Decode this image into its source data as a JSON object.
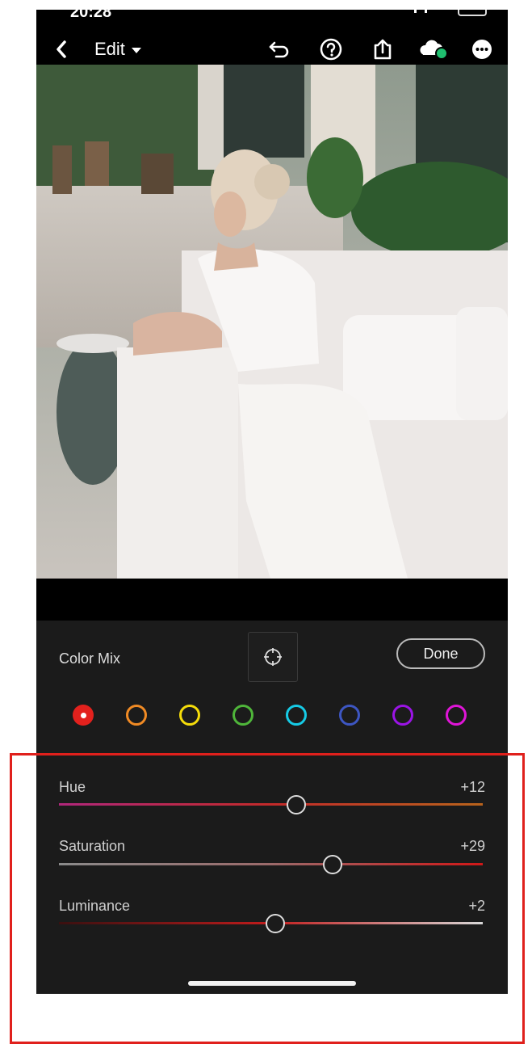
{
  "status_bar": {
    "time": "20:28"
  },
  "nav": {
    "title": "Edit"
  },
  "panel": {
    "title": "Color Mix",
    "done_label": "Done",
    "swatches": [
      {
        "name": "red",
        "color": "#e3211d",
        "selected": true
      },
      {
        "name": "orange",
        "color": "#f08a24",
        "selected": false
      },
      {
        "name": "yellow",
        "color": "#f5dc0a",
        "selected": false
      },
      {
        "name": "green",
        "color": "#4fb63a",
        "selected": false
      },
      {
        "name": "aqua",
        "color": "#16cbe6",
        "selected": false
      },
      {
        "name": "blue",
        "color": "#3d56c2",
        "selected": false
      },
      {
        "name": "purple",
        "color": "#9b14e6",
        "selected": false
      },
      {
        "name": "magenta",
        "color": "#e015d8",
        "selected": false
      }
    ],
    "sliders": [
      {
        "label": "Hue",
        "value": 12,
        "value_text": "+12"
      },
      {
        "label": "Saturation",
        "value": 29,
        "value_text": "+29"
      },
      {
        "label": "Luminance",
        "value": 2,
        "value_text": "+2"
      }
    ],
    "slider_range": [
      -100,
      100
    ]
  },
  "colors": {
    "panel_bg": "#1b1b1b",
    "highlight": "#e0201c",
    "cloud_status": "#1fbf6f"
  }
}
